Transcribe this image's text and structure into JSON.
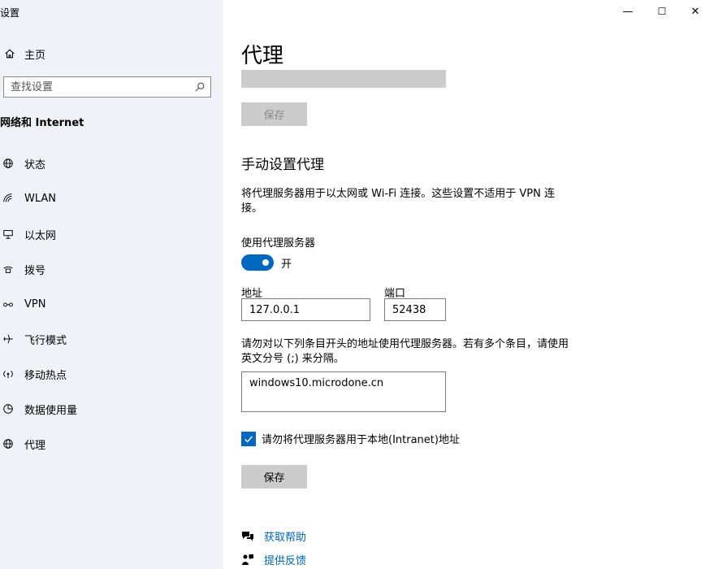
{
  "window": {
    "title": "设置",
    "controls": {
      "minimize": "—",
      "maximize": "☐",
      "close": "✕"
    }
  },
  "sidebar": {
    "home_label": "主页",
    "search": {
      "placeholder": "查找设置",
      "value": ""
    },
    "section_title": "网络和 Internet",
    "items": [
      {
        "label": "状态",
        "icon": "globe-status-icon"
      },
      {
        "label": "WLAN",
        "icon": "wifi-icon"
      },
      {
        "label": "以太网",
        "icon": "ethernet-icon"
      },
      {
        "label": "拨号",
        "icon": "dialup-icon"
      },
      {
        "label": "VPN",
        "icon": "vpn-icon"
      },
      {
        "label": "飞行模式",
        "icon": "airplane-icon"
      },
      {
        "label": "移动热点",
        "icon": "hotspot-icon"
      },
      {
        "label": "数据使用量",
        "icon": "data-usage-icon"
      },
      {
        "label": "代理",
        "icon": "proxy-globe-icon"
      }
    ]
  },
  "main": {
    "page_title": "代理",
    "save_disabled_label": "保存",
    "manual_section_title": "手动设置代理",
    "manual_description": "将代理服务器用于以太网或 Wi-Fi 连接。这些设置不适用于 VPN 连接。",
    "use_proxy_label": "使用代理服务器",
    "toggle": {
      "state": "on",
      "label": "开"
    },
    "address": {
      "label": "地址",
      "value": "127.0.0.1"
    },
    "port": {
      "label": "端口",
      "value": "52438"
    },
    "exceptions_description": "请勿对以下列条目开头的地址使用代理服务器。若有多个条目，请使用英文分号 (;) 来分隔。",
    "exceptions_value": "windows10.microdone.cn",
    "bypass_local": {
      "checked": true,
      "label": "请勿将代理服务器用于本地(Intranet)地址"
    },
    "save_label": "保存",
    "links": [
      {
        "label": "获取帮助",
        "icon": "help-chat-icon"
      },
      {
        "label": "提供反馈",
        "icon": "feedback-icon"
      }
    ]
  },
  "colors": {
    "accent": "#0067c0",
    "sidebar_bg": "#f0f2f7",
    "button_bg": "#cccccc",
    "link": "#0063b1"
  }
}
